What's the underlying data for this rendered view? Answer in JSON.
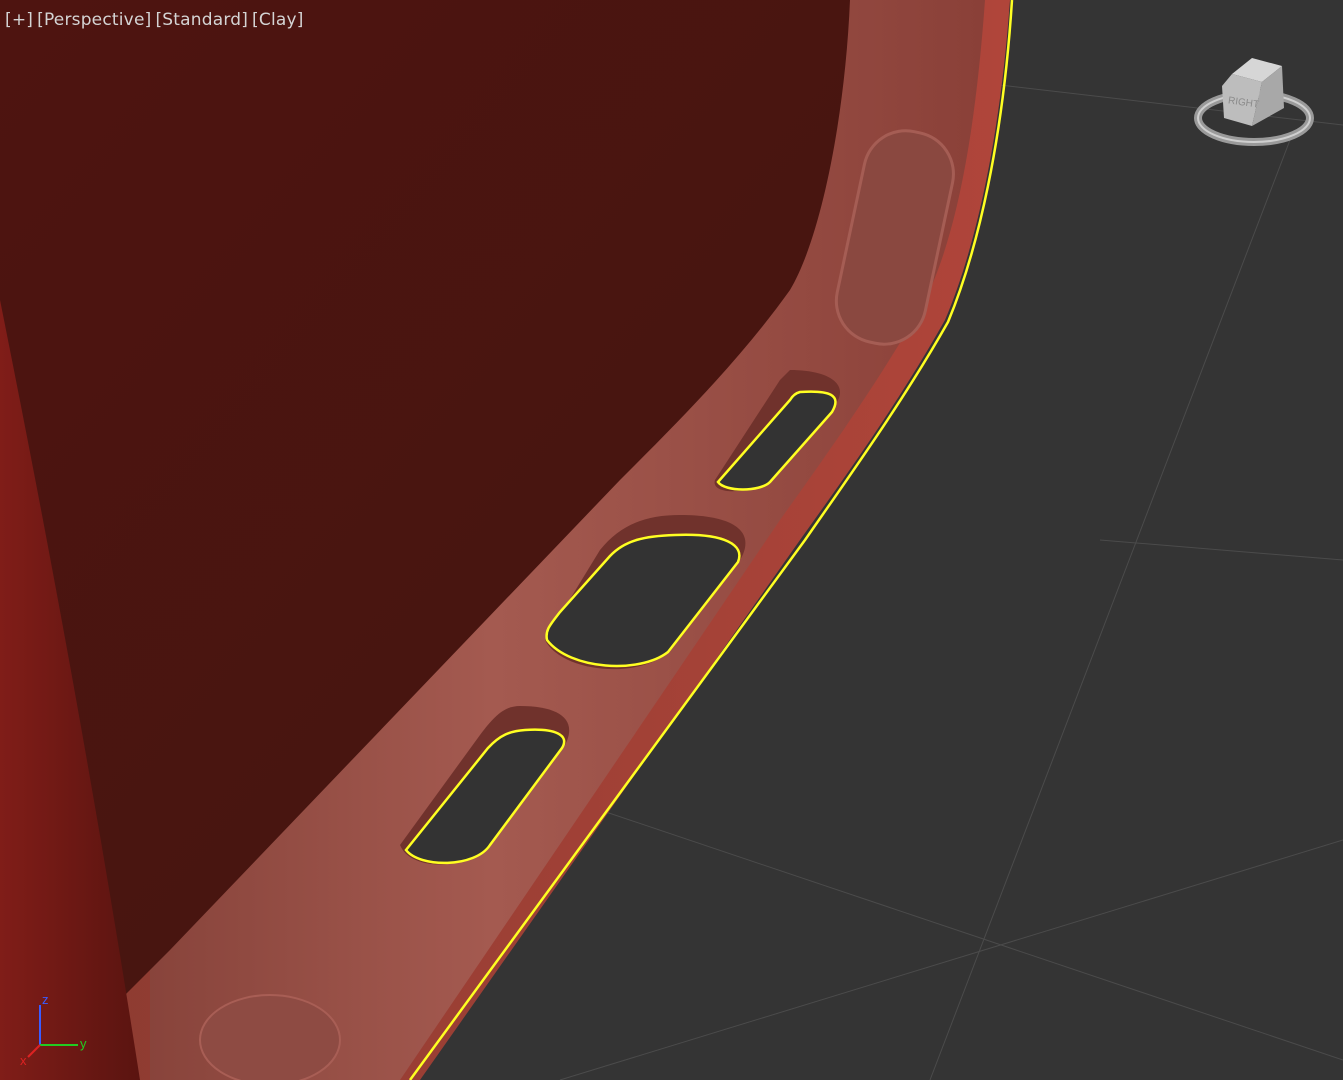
{
  "viewport": {
    "labels": {
      "plus": "[+]",
      "view": "[Perspective]",
      "shading": "[Standard]",
      "style": "[Clay]"
    },
    "viewcube_face": "RIGHT",
    "axes": {
      "z": "z",
      "y": "y",
      "x": "x"
    },
    "colors": {
      "background": "#343434",
      "grid": "#4a4a4a",
      "object_outer": "#7a1a16",
      "object_inner": "#4a1510",
      "rim": "#9a4a42",
      "selection": "#ffff22"
    }
  }
}
